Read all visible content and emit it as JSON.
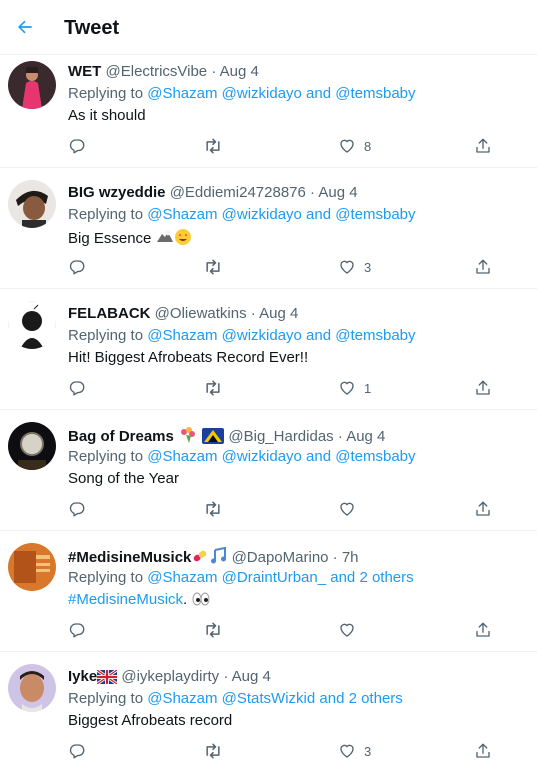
{
  "header": {
    "title": "Tweet",
    "back_icon": "arrow-left-icon"
  },
  "colors": {
    "link": "#1d9bf0",
    "secondary": "#536471",
    "text": "#0f1419"
  },
  "tweets": [
    {
      "name": "WET",
      "handle": "@ElectricsVibe",
      "time": "Aug 4",
      "reply_prefix": "Replying to ",
      "reply_targets": "@Shazam @wizkidayo and @temsbaby",
      "text": "As it should",
      "text_extra": "",
      "likes": "8"
    },
    {
      "name": "BIG wzyeddie",
      "handle": "@Eddiemi24728876",
      "time": "Aug 4",
      "reply_prefix": "Replying to ",
      "reply_targets": "@Shazam @wizkidayo and @temsbaby",
      "text": "Big Essence",
      "text_extra": "",
      "likes": "3"
    },
    {
      "name": "FELABACK",
      "handle": "@Oliewatkins",
      "time": "Aug 4",
      "reply_prefix": "Replying to ",
      "reply_targets": "@Shazam @wizkidayo and @temsbaby",
      "text": "Hit! Biggest Afrobeats Record Ever!!",
      "text_extra": "",
      "likes": "1"
    },
    {
      "name": "Bag of Dreams",
      "handle": "@Big_Hardidas",
      "time": "Aug 4",
      "reply_prefix": "Replying to ",
      "reply_targets": "@Shazam @wizkidayo and @temsbaby",
      "text": "Song of the Year",
      "text_extra": "",
      "likes": ""
    },
    {
      "name": "#MedisineMusick",
      "handle": "@DapoMarino",
      "time": "7h",
      "reply_prefix": "Replying to ",
      "reply_targets": "@Shazam @DraintUrban_ and 2 others",
      "text": "#MedisineMusick",
      "text_extra": ".",
      "likes": ""
    },
    {
      "name": "Iyke",
      "handle": "@iykeplaydirty",
      "time": "Aug 4",
      "reply_prefix": "Replying to ",
      "reply_targets": "@Shazam @StatsWizkid and 2 others",
      "text": "Biggest Afrobeats record",
      "text_extra": "",
      "likes": "3"
    }
  ]
}
